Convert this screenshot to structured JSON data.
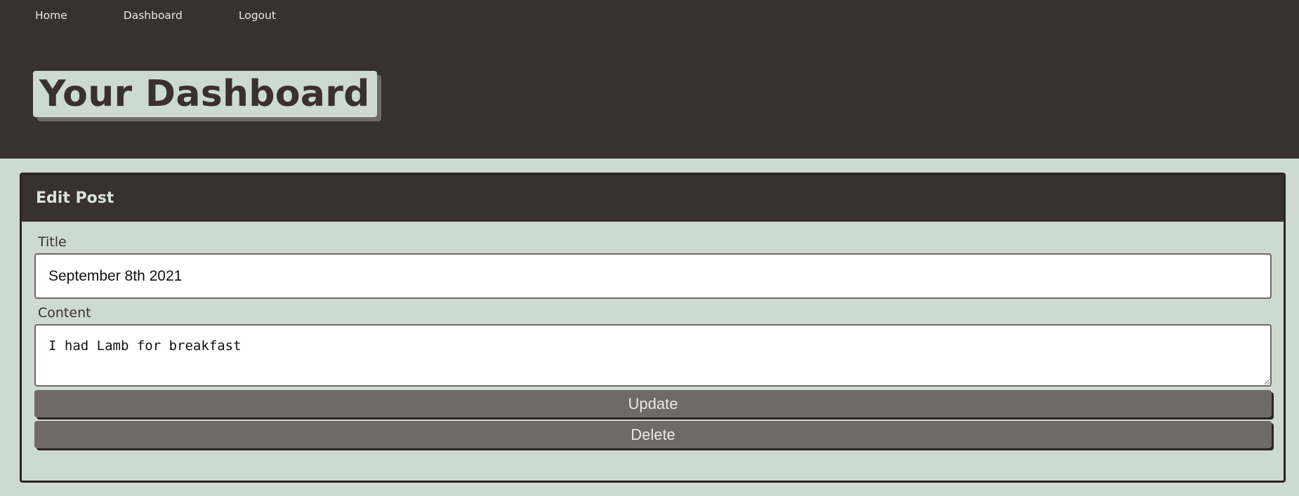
{
  "nav": {
    "items": [
      {
        "label": "Home"
      },
      {
        "label": "Dashboard"
      },
      {
        "label": "Logout"
      }
    ]
  },
  "header": {
    "title": "Your Dashboard"
  },
  "card": {
    "title": "Edit Post",
    "title_label": "Title",
    "title_value": "September 8th 2021",
    "content_label": "Content",
    "content_value": "I had Lamb for breakfast",
    "update_label": "Update",
    "delete_label": "Delete"
  },
  "colors": {
    "header_bg": "#393030",
    "page_bg": "#cddad1",
    "button_bg": "#716868"
  }
}
